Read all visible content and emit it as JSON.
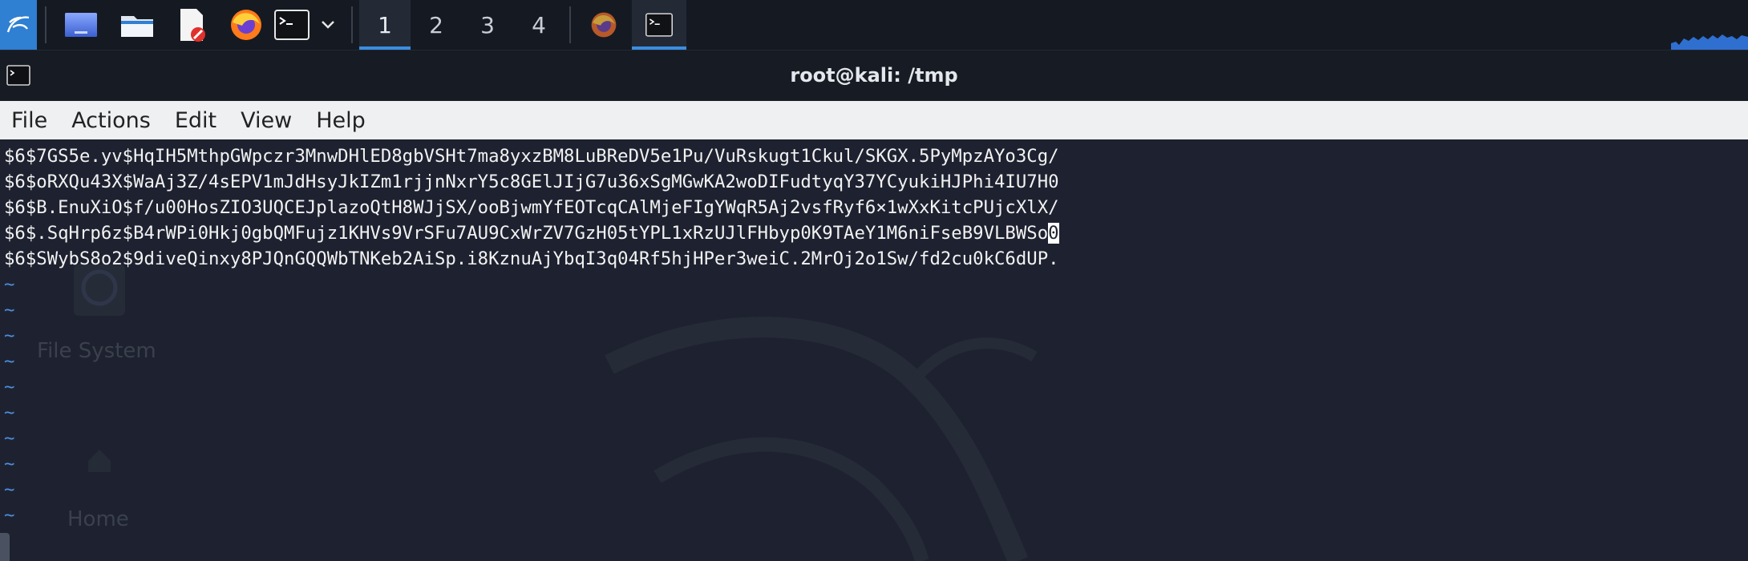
{
  "taskbar": {
    "workspaces": [
      "1",
      "2",
      "3",
      "4"
    ],
    "active_workspace": "1"
  },
  "window": {
    "title": "root@kali: /tmp"
  },
  "menubar": {
    "items": [
      "File",
      "Actions",
      "Edit",
      "View",
      "Help"
    ]
  },
  "terminal": {
    "lines": [
      "$6$7GS5e.yv$HqIH5MthpGWpczr3MnwDHlED8gbVSHt7ma8yxzBM8LuBReDV5e1Pu/VuRskugt1Ckul/SKGX.5PyMpzAYo3Cg/",
      "$6$oRXQu43X$WaAj3Z/4sEPV1mJdHsyJkIZm1rjjnNxrY5c8GElJIjG7u36xSgMGwKA2woDIFudtyqY37YCyukiHJPhi4IU7H0",
      "$6$B.EnuXiO$f/u00HosZIO3UQCEJplazoQtH8WJjSX/ooBjwmYfEOTcqCAlMjeFIgYWqR5Aj2vsfRyf6×1wXxKitcPUjcXlX/",
      "$6$.SqHrp6z$B4rWPi0Hkj0gbQMFujz1KHVs9VrSFu7AU9CxWrZV7GzH05tYPL1xRzUJlFHbyp0K9TAeY1M6niFseB9VLBWSo",
      "$6$SWybS8o2$9diveQinxy8PJQnGQQWbTNKeb2AiSp.i8KznuAjYbqI3q04Rf5hjHPer3weiC.2MrOj2o1Sw/fd2cu0kC6dUP."
    ],
    "cursor_char": "0",
    "tilde": "~"
  },
  "desktop_labels": {
    "file_system": "File System",
    "home": "Home"
  },
  "colors": {
    "accent": "#3b8ee0",
    "terminal_bg": "#1e2230",
    "tilde": "#4d8ee0"
  }
}
